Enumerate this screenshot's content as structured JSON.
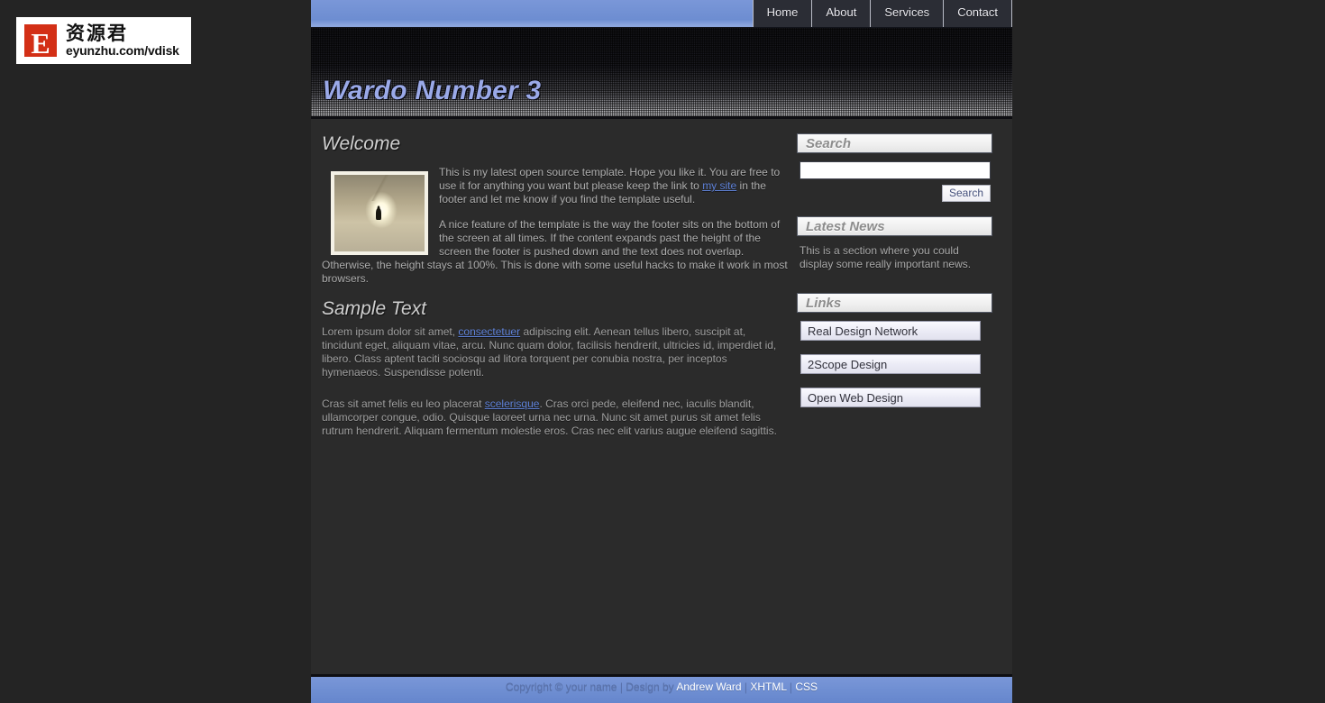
{
  "watermark": {
    "badge_letter": "E",
    "chinese": "资源君",
    "url": "eyunzhu.com/vdisk"
  },
  "nav": {
    "items": [
      {
        "label": "Home"
      },
      {
        "label": "About"
      },
      {
        "label": "Services"
      },
      {
        "label": "Contact"
      }
    ]
  },
  "header": {
    "title": "Wardo Number 3"
  },
  "content": {
    "welcome_title": "Welcome",
    "intro_p1_before": "This is my latest open source template. Hope you like it. You are free to use it for anything you want but please keep the link to ",
    "intro_p1_link": "my site",
    "intro_p1_after": " in the footer and let me know if you find the template useful.",
    "intro_p2": "A nice feature of the template is the way the footer sits on the bottom of the screen at all times. If the content expands past the height of the screen the footer is pushed down and the text does not overlap. Otherwise, the height stays at 100%. This is done with some useful hacks to make it work in most browsers.",
    "sample_title": "Sample Text",
    "lorem1_before": "Lorem ipsum dolor sit amet, ",
    "lorem1_link": "consectetuer",
    "lorem1_after": " adipiscing elit. Aenean tellus libero, suscipit at, tincidunt eget, aliquam vitae, arcu. Nunc quam dolor, facilisis hendrerit, ultricies id, imperdiet id, libero. Class aptent taciti sociosqu ad litora torquent per conubia nostra, per inceptos hymenaeos. Suspendisse potenti.",
    "lorem2_before": "Cras sit amet felis eu leo placerat ",
    "lorem2_link": "scelerisque",
    "lorem2_after": ". Cras orci pede, eleifend nec, iaculis blandit, ullamcorper congue, odio. Quisque laoreet urna nec urna. Nunc sit amet purus sit amet felis rutrum hendrerit. Aliquam fermentum molestie eros. Cras nec elit varius augue eleifend sagittis.",
    "thumb_alt": "tunnel-with-light-photo"
  },
  "sidebar": {
    "search_heading": "Search",
    "search_value": "",
    "search_placeholder": "",
    "search_button": "Search",
    "news_heading": "Latest News",
    "news_text": "This is a section where you could display some really important news.",
    "links_heading": "Links",
    "links": [
      {
        "label": "Real Design Network"
      },
      {
        "label": "2Scope Design"
      },
      {
        "label": "Open Web Design"
      }
    ]
  },
  "footer": {
    "copyright": "Copyright © your name | Design by ",
    "author_link": "Andrew Ward",
    "sep1": " | ",
    "xhtml_link": "XHTML",
    "sep2": " | ",
    "css_link": "CSS"
  },
  "colors": {
    "accent_blue": "#6d8dd1",
    "page_bg": "#242424",
    "content_bg": "#2b2b2b",
    "link_blue": "#5f82d8",
    "title_blue": "#9aa9e8",
    "watermark_red": "#d32f16"
  }
}
